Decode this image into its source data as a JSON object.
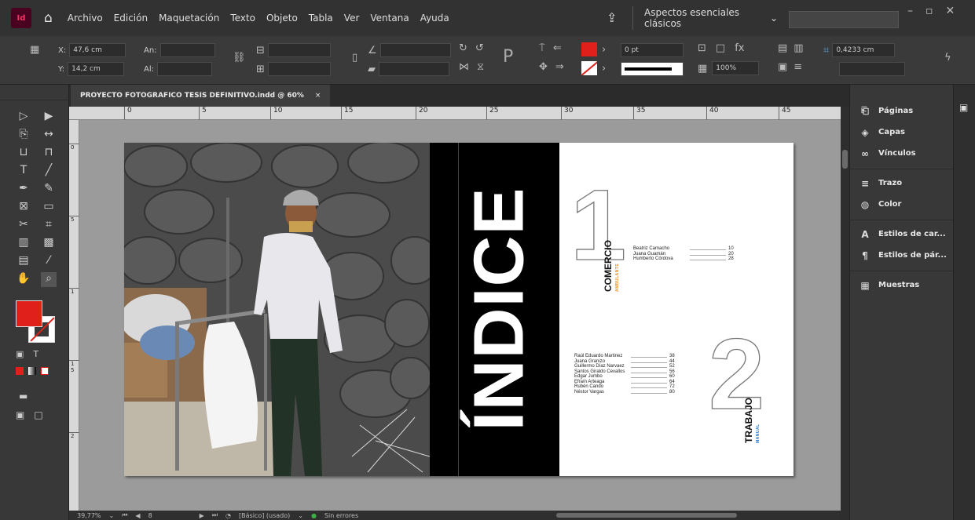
{
  "app": {
    "logo": "Id",
    "menus": [
      "Archivo",
      "Edición",
      "Maquetación",
      "Texto",
      "Objeto",
      "Tabla",
      "Ver",
      "Ventana",
      "Ayuda"
    ],
    "workspace": "Aspectos esenciales clásicos"
  },
  "control": {
    "x_label": "X:",
    "x_value": "47,6 cm",
    "y_label": "Y:",
    "y_value": "14,2 cm",
    "w_label": "An:",
    "h_label": "Al:",
    "stroke_weight": "0 pt",
    "zoom_field": "100%",
    "gap_value": "0,4233 cm"
  },
  "document": {
    "tab_title": "PROYECTO FOTOGRAFICO TESIS DEFINITIVO.indd @ 60%",
    "tab_close": "×"
  },
  "ruler": {
    "h_ticks": [
      "0",
      "5",
      "10",
      "15",
      "20",
      "25",
      "30",
      "35",
      "40",
      "45"
    ],
    "v_ticks": [
      "0",
      "5",
      "1",
      "1 5",
      "2"
    ]
  },
  "layout": {
    "title": "ÍNDICE",
    "section1": {
      "number": "1",
      "heading": "COMERCIO",
      "subheading": "AMBULANTE",
      "subheading_color": "#f08a1c",
      "entries": [
        {
          "name": "Beatriz Camacho",
          "page": "10"
        },
        {
          "name": "Juana Guamán",
          "page": "20"
        },
        {
          "name": "Humberto Córdova",
          "page": "28"
        }
      ]
    },
    "section2": {
      "number": "2",
      "heading": "TRABAJO",
      "subheading": "MANUAL",
      "subheading_color": "#1e73c8",
      "entries": [
        {
          "name": "Raúl Eduardo Martinez",
          "page": "38"
        },
        {
          "name": "Juana Granizo",
          "page": "44"
        },
        {
          "name": "Guillermo Díaz Narvaez",
          "page": "52"
        },
        {
          "name": "Santos Giraldo Cevallos",
          "page": "56"
        },
        {
          "name": "Edgar Jumbo",
          "page": "60"
        },
        {
          "name": "Efraín Arteaga",
          "page": "64"
        },
        {
          "name": "Rubén Cando",
          "page": "72"
        },
        {
          "name": "Néstor Vargas",
          "page": "80"
        }
      ]
    }
  },
  "panels": [
    {
      "label": "Páginas",
      "icon": "pages-icon"
    },
    {
      "label": "Capas",
      "icon": "layers-icon"
    },
    {
      "label": "Vínculos",
      "icon": "links-icon"
    },
    {
      "label": "Trazo",
      "icon": "stroke-icon"
    },
    {
      "label": "Color",
      "icon": "color-icon"
    },
    {
      "label": "Estilos de car...",
      "icon": "character-styles-icon"
    },
    {
      "label": "Estilos de pár...",
      "icon": "paragraph-styles-icon"
    },
    {
      "label": "Muestras",
      "icon": "swatches-icon"
    }
  ],
  "status": {
    "zoom": "39,77%",
    "page": "8",
    "style": "[Básico] (usado)",
    "preflight": "Sin errores"
  },
  "colors": {
    "fill": "#e0201b",
    "preflight_ok": "#3cb043"
  }
}
